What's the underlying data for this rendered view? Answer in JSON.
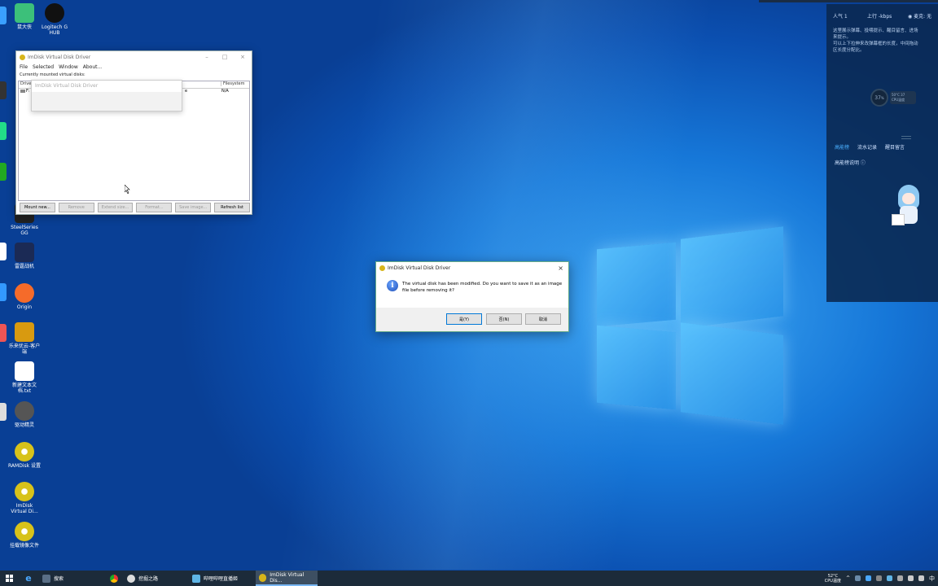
{
  "desktop": {
    "icons": [
      {
        "label": "鼠大侠"
      },
      {
        "label": "Logitech G HUB"
      },
      {
        "label": "SteelSeries GG"
      },
      {
        "label": "雷霆战机"
      },
      {
        "label": "Origin"
      },
      {
        "label": "乐来优云-客户端"
      },
      {
        "label": "新建文本文档.txt"
      },
      {
        "label": "驱动精灵"
      },
      {
        "label": "RAMDisk 设置"
      },
      {
        "label": "ImDisk Virtual Di..."
      },
      {
        "label": "挂载镜像文件"
      }
    ]
  },
  "main_window": {
    "title": "ImDisk Virtual Disk Driver",
    "menu": [
      "File",
      "Selected",
      "Window",
      "About..."
    ],
    "list_caption": "Currently mounted virtual disks:",
    "columns": [
      "Drive",
      "Filesystem"
    ],
    "rows": [
      {
        "drive": "F:",
        "size_type": "e",
        "filesystem": "N/A"
      }
    ],
    "popup_title": "ImDisk Virtual Disk Driver",
    "buttons": {
      "mount": "Mount new...",
      "remove": "Remove",
      "extend": "Extend size...",
      "format": "Format...",
      "save": "Save image...",
      "refresh": "Refresh list"
    }
  },
  "dialog": {
    "title": "ImDisk Virtual Disk Driver",
    "message_line1": "The virtual disk has been modified. Do you want to save it as an image",
    "message_line2": "file before removing it?",
    "yes": "是(Y)",
    "no": "否(N)",
    "cancel": "取消"
  },
  "side_panel": {
    "popularity": "人气  1",
    "upload": "上行  -kbps",
    "mic": "◉ 麦克: 无",
    "notice_line1": "这里展示弹幕、投喂提示、醒目留言、进场",
    "notice_line2": "来提示。",
    "notice_line3": "可以上下拉伸来改弹幕框的长度，中间拖动",
    "notice_line4": "区长度分配比。",
    "cpu_percent": "37",
    "cpu_percent_suffix": "%",
    "cpu_temp": "50°C 37",
    "cpu_label": "CPU温度",
    "tabs": [
      "高能榜",
      "流水记录",
      "醒目留言"
    ],
    "rank_caption": "高能榜说明 ⓘ"
  },
  "taskbar": {
    "items": [
      {
        "label": "搜索"
      },
      {
        "label": "挖掘之路"
      },
      {
        "label": "哔哩哔哩直播姬"
      },
      {
        "label": "ImDisk Virtual Dis..."
      }
    ],
    "temp": "52°C",
    "temp_label": "CPU温度",
    "ime": "中"
  },
  "colors": {
    "accent": "#1677d8",
    "taskbar": "#1c2b3a",
    "panel": "#0a2850"
  }
}
